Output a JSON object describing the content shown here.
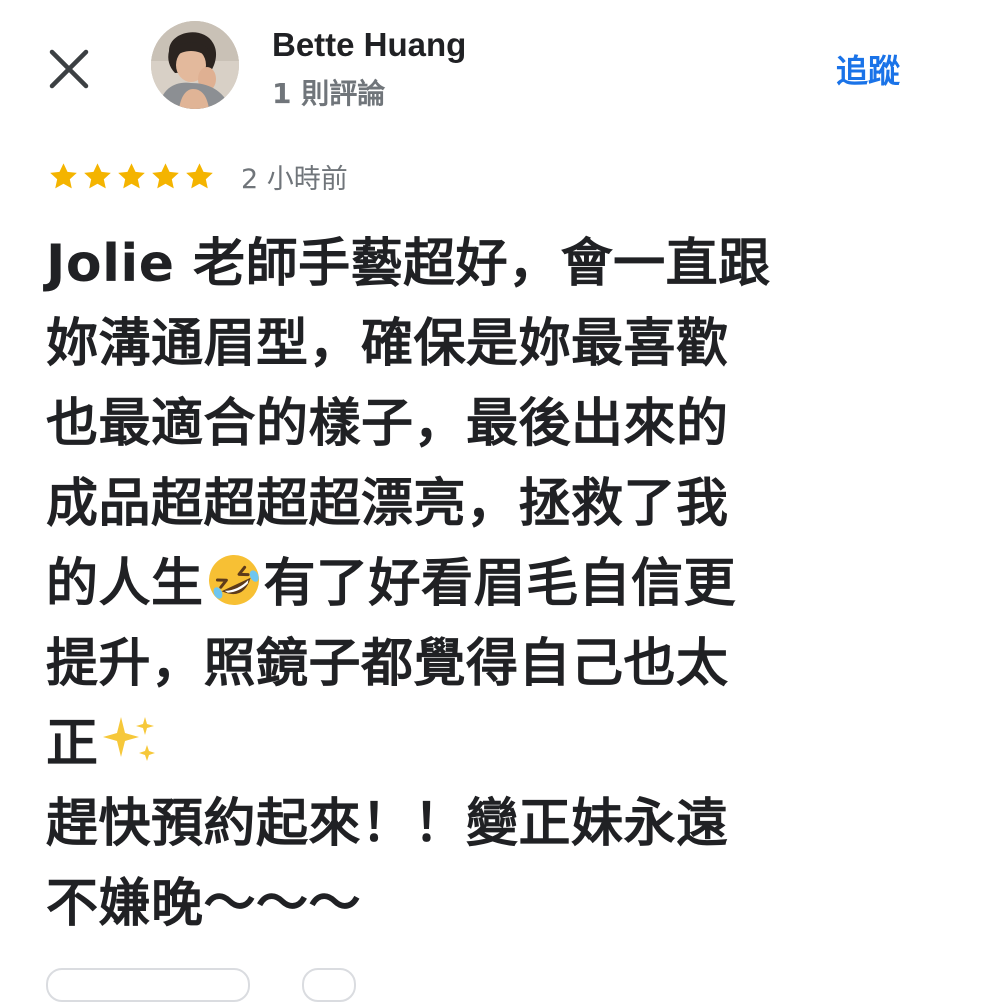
{
  "header": {
    "user_name": "Bette Huang",
    "review_count": "1 則評論",
    "follow_label": "追蹤"
  },
  "icons": {
    "close": "close-icon",
    "star": "star-icon",
    "emoji_laugh": "rolling-on-floor-laughing-emoji",
    "sparkles": "sparkles-emoji"
  },
  "review": {
    "rating": 5,
    "time_ago": "2 小時前",
    "lines": [
      "Jolie 老師手藝超好，會一直跟",
      "妳溝通眉型，確保是妳最喜歡",
      "也最適合的樣子，最後出來的",
      "成品超超超超漂亮，拯救了我",
      "的人生",
      "有了好看眉毛自信更",
      "提升，照鏡子都覺得自己也太",
      "正",
      "趕快預約起來！！變正妹永遠",
      "不嫌晚～～～"
    ]
  },
  "colors": {
    "star": "#f4b400",
    "link": "#1a73e8",
    "secondary_text": "#70757a",
    "primary_text": "#202124"
  }
}
